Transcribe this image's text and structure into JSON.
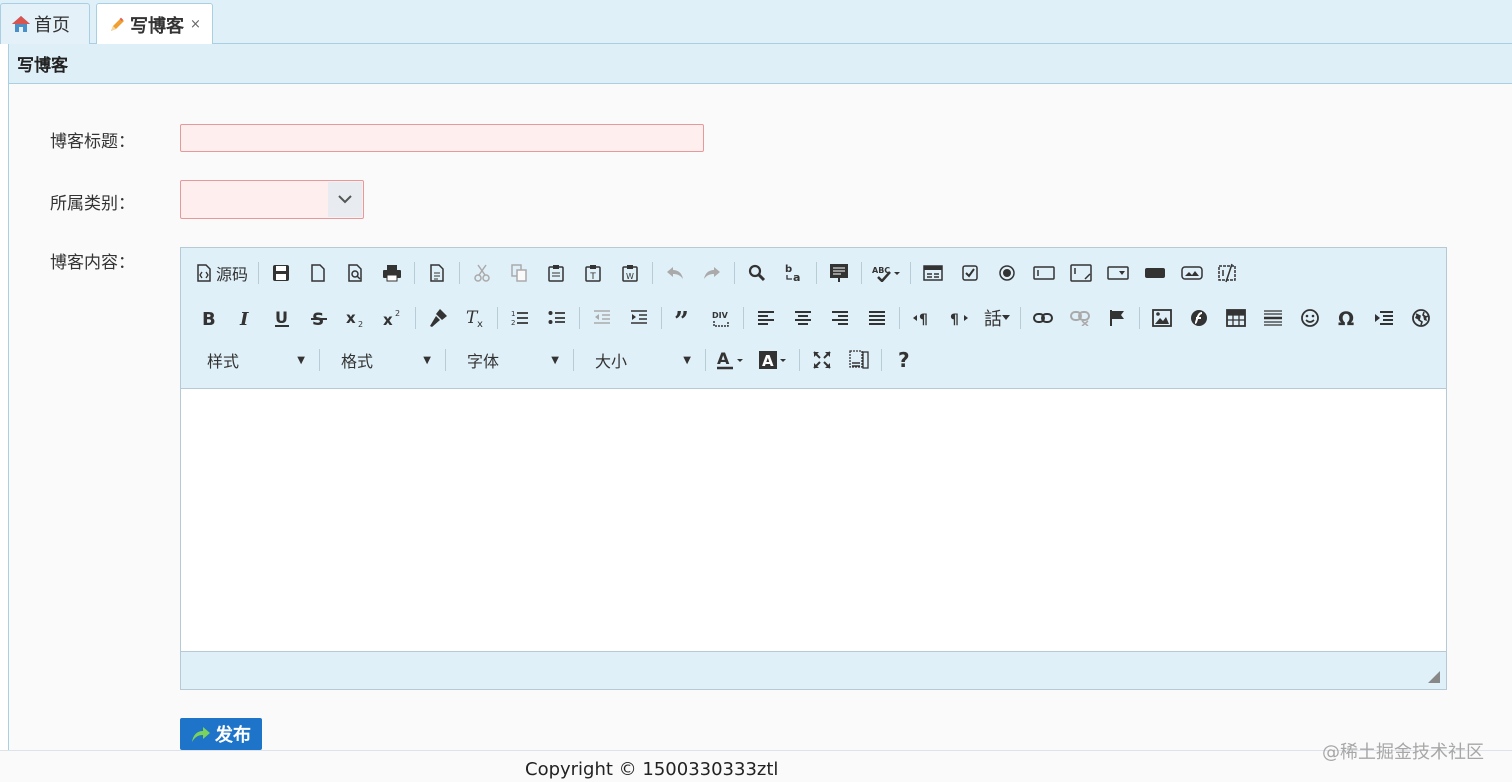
{
  "tabs": [
    {
      "label": "首页",
      "icon": "home-icon"
    },
    {
      "label": "写博客",
      "icon": "pencil-icon",
      "close": "×"
    }
  ],
  "panel": {
    "title": "写博客"
  },
  "form": {
    "title_label": "博客标题：",
    "category_label": "所属类别：",
    "content_label": "博客内容：",
    "category_value": "",
    "title_value": ""
  },
  "editor": {
    "source_label": "源码",
    "combos": {
      "style": "样式",
      "format": "格式",
      "font": "字体",
      "size": "大小"
    },
    "language_label": "話"
  },
  "publish_label": "发布",
  "footer": {
    "copyright": "Copyright © 1500330333ztl"
  },
  "watermark": "@稀土掘金技术社区",
  "colors": {
    "accent": "#1e74c8",
    "header_bg": "#deeff8",
    "invalid_bg": "#ffeeee"
  }
}
